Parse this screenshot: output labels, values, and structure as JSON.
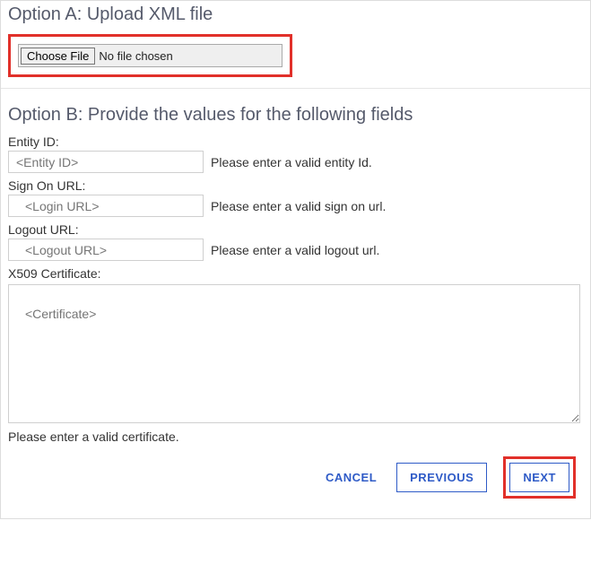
{
  "optionA": {
    "title": "Option A: Upload XML file",
    "choose_label": "Choose File",
    "no_file_label": "No file chosen"
  },
  "optionB": {
    "title": "Option B: Provide the values for the following fields",
    "entity": {
      "label": "Entity ID:",
      "placeholder": "<Entity ID>",
      "hint": "Please enter a valid entity Id."
    },
    "signon": {
      "label": "Sign On URL:",
      "placeholder": "<Login URL>",
      "hint": "Please enter a valid sign on url."
    },
    "logout": {
      "label": "Logout URL:",
      "placeholder": "<Logout URL>",
      "hint": "Please enter a valid logout url."
    },
    "cert": {
      "label": "X509 Certificate:",
      "placeholder": "<Certificate>",
      "hint": "Please enter a valid certificate."
    }
  },
  "footer": {
    "cancel": "CANCEL",
    "previous": "PREVIOUS",
    "next": "NEXT"
  }
}
